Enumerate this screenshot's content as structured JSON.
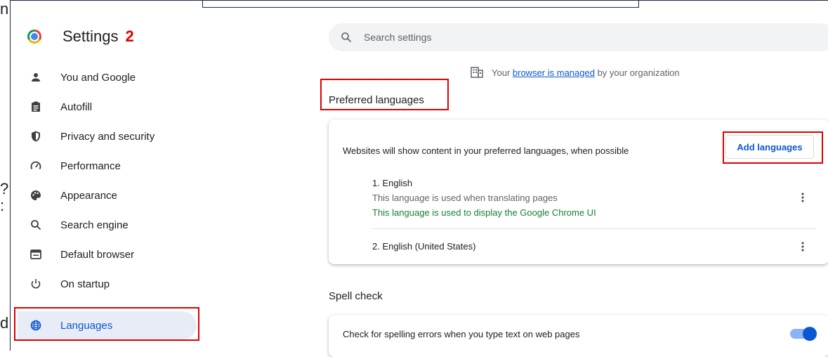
{
  "edge_text": [
    "n",
    "?",
    ":",
    "d"
  ],
  "app": {
    "title": "Settings",
    "badge": "2"
  },
  "sidebar": {
    "items": [
      {
        "label": "You and Google",
        "icon": "person-icon"
      },
      {
        "label": "Autofill",
        "icon": "clipboard-icon"
      },
      {
        "label": "Privacy and security",
        "icon": "shield-icon"
      },
      {
        "label": "Performance",
        "icon": "speedometer-icon"
      },
      {
        "label": "Appearance",
        "icon": "palette-icon"
      },
      {
        "label": "Search engine",
        "icon": "search-icon"
      },
      {
        "label": "Default browser",
        "icon": "browser-window-icon"
      },
      {
        "label": "On startup",
        "icon": "power-icon"
      },
      {
        "label": "Languages",
        "icon": "globe-icon",
        "active": true
      }
    ]
  },
  "search": {
    "placeholder": "Search settings"
  },
  "managed": {
    "prefix": "Your ",
    "link": "browser is managed",
    "suffix": " by your organization"
  },
  "preferred": {
    "title": "Preferred languages",
    "description": "Websites will show content in your preferred languages, when possible",
    "add_label": "Add languages",
    "languages": [
      {
        "name": "1. English",
        "note": "This language is used when translating pages",
        "ui_note": "This language is used to display the Google Chrome UI"
      },
      {
        "name": "2. English (United States)"
      }
    ]
  },
  "spell": {
    "title": "Spell check",
    "description": "Check for spelling errors when you type text on web pages",
    "enabled": true
  },
  "colors": {
    "accent": "#0b57d0",
    "highlight": "#e00000",
    "green": "#188038",
    "active_bg": "#e7ecf7"
  }
}
